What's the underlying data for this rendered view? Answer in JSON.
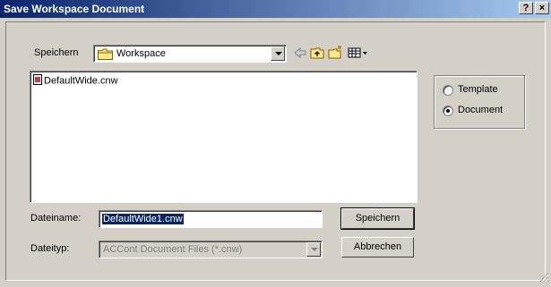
{
  "window": {
    "title": "Save Workspace Document",
    "help_label": "?",
    "close_label": "×"
  },
  "location": {
    "label": "Speichern",
    "value": "Workspace"
  },
  "toolbar_icons": [
    "back-icon",
    "up-folder-icon",
    "new-folder-icon",
    "view-menu-icon"
  ],
  "files": [
    {
      "name": "DefaultWide.cnw",
      "icon": "document-icon"
    }
  ],
  "doc_type": {
    "options": [
      {
        "label": "Template",
        "checked": false
      },
      {
        "label": "Document",
        "checked": true
      }
    ]
  },
  "filename": {
    "label": "Dateiname:",
    "value": "DefaultWide1.cnw"
  },
  "filetype": {
    "label": "Dateityp:",
    "value": "ACCont Document Files (*.cnw)"
  },
  "buttons": {
    "save": "Speichern",
    "cancel": "Abbrechen"
  },
  "colors": {
    "face": "#d4d0c8",
    "title_start": "#0a246a",
    "title_end": "#a6caf0",
    "selection": "#0a246a"
  }
}
